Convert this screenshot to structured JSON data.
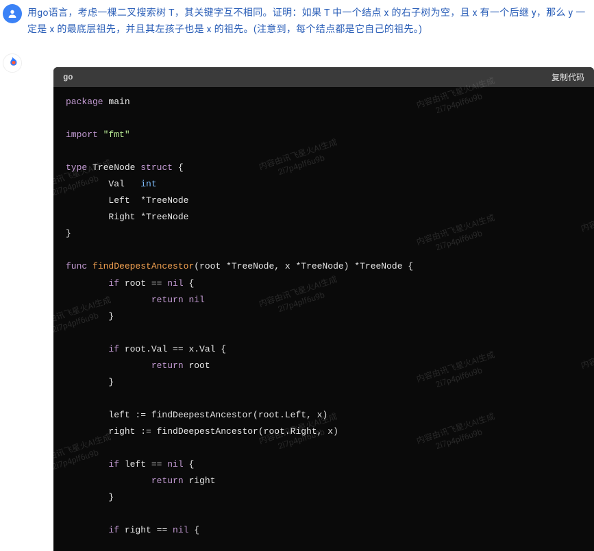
{
  "user_message": "用go语言，考虑一棵二叉搜索树 T，其关键字互不相同。证明：如果 T 中一个结点 x 的右子树为空，且 x 有一个后继 y，那么 y 一定是 x 的最底层祖先，并且其左孩子也是 x 的祖先。(注意到，每个结点都是它自己的祖先。)",
  "code": {
    "lang": "go",
    "copy_label": "复制代码",
    "lines": {
      "l1_kw": "package",
      "l1_id": " main",
      "l3_kw": "import",
      "l3_str": " \"fmt\"",
      "l5_kw": "type",
      "l5_id": " TreeNode ",
      "l5_kw2": "struct",
      "l5_tail": " {",
      "l6": "        Val   ",
      "l6_typ": "int",
      "l7": "        Left  *TreeNode",
      "l8": "        Right *TreeNode",
      "l9": "}",
      "l11_kw": "func",
      "l11_fn": " findDeepestAncestor",
      "l11_rest": "(root *TreeNode, x *TreeNode) *TreeNode {",
      "l12": "        ",
      "l12_kw": "if",
      "l12_rest": " root == ",
      "l12_nil": "nil",
      "l12_tail": " {",
      "l13": "                ",
      "l13_kw": "return",
      "l13_sp": " ",
      "l13_nil": "nil",
      "l14": "        }",
      "l16": "        ",
      "l16_kw": "if",
      "l16_rest": " root.Val == x.Val {",
      "l17": "                ",
      "l17_kw": "return",
      "l17_rest": " root",
      "l18": "        }",
      "l20": "        left := findDeepestAncestor(root.Left, x)",
      "l21": "        right := findDeepestAncestor(root.Right, x)",
      "l23": "        ",
      "l23_kw": "if",
      "l23_rest": " left == ",
      "l23_nil": "nil",
      "l23_tail": " {",
      "l24": "                ",
      "l24_kw": "return",
      "l24_rest": " right",
      "l25": "        }",
      "l27": "        ",
      "l27_kw": "if",
      "l27_rest": " right == ",
      "l27_nil": "nil",
      "l27_tail": " {"
    }
  },
  "watermark": {
    "line1": "内容由讯飞星火AI生成",
    "line2": "2i7p4plf6u9b"
  }
}
